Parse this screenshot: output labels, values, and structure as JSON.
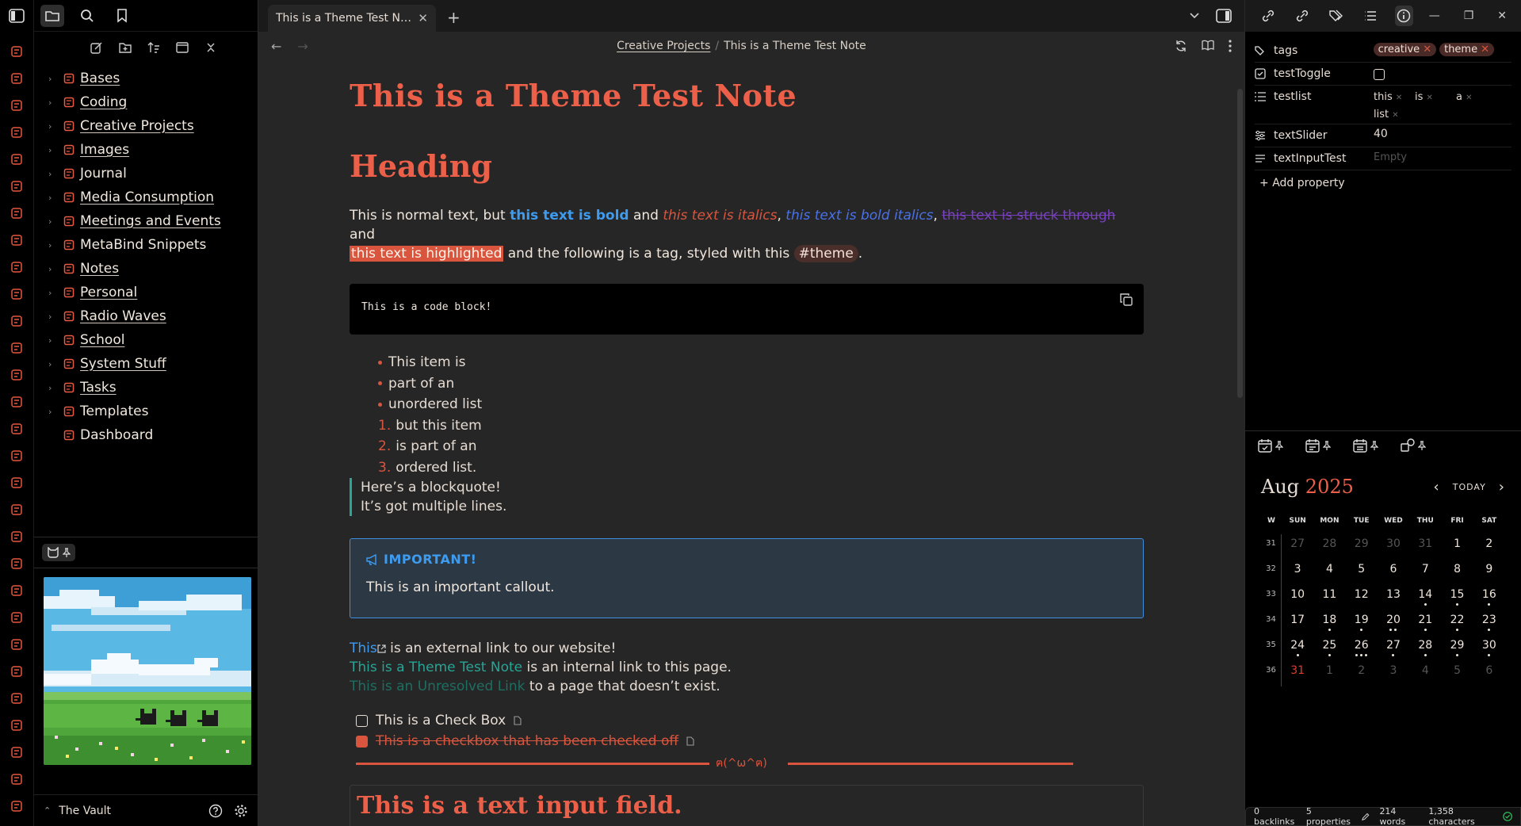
{
  "colors": {
    "accent": "#ec5f48",
    "link": "#3e9cf0",
    "internal": "#27a596"
  },
  "left_sidebar": {
    "tree": [
      {
        "label": "Bases",
        "icon": "database-icon",
        "underline": true
      },
      {
        "label": "Coding",
        "icon": "code-icon",
        "underline": true
      },
      {
        "label": "Creative Projects",
        "icon": "palette-icon",
        "underline": true
      },
      {
        "label": "Images",
        "icon": "image-icon",
        "underline": true
      },
      {
        "label": "Journal",
        "icon": "journal-icon",
        "underline": false
      },
      {
        "label": "Media Consumption",
        "icon": "tv-icon",
        "underline": true
      },
      {
        "label": "Meetings and Events",
        "icon": "monitor-icon",
        "underline": true
      },
      {
        "label": "MetaBind Snippets",
        "icon": "scissors-icon",
        "underline": false
      },
      {
        "label": "Notes",
        "icon": "note-icon",
        "underline": true
      },
      {
        "label": "Personal",
        "icon": "person-icon",
        "underline": true
      },
      {
        "label": "Radio Waves",
        "icon": "radio-icon",
        "underline": true
      },
      {
        "label": "School",
        "icon": "school-icon",
        "underline": true
      },
      {
        "label": "System Stuff",
        "icon": "gear-icon",
        "underline": true
      },
      {
        "label": "Tasks",
        "icon": "tasks-icon",
        "underline": true
      },
      {
        "label": "Templates",
        "icon": "template-icon",
        "underline": false
      },
      {
        "label": "Dashboard",
        "icon": "dashboard-icon",
        "underline": false,
        "no_chevron": true
      }
    ],
    "vault_name": "The Vault"
  },
  "tab": {
    "title": "This is a Theme Test N…"
  },
  "breadcrumb": {
    "folder": "Creative Projects",
    "sep": "/",
    "note": "This is a Theme Test Note"
  },
  "note": {
    "title": "This is a Theme Test Note",
    "heading": "Heading",
    "p1": {
      "t1": "This is normal text, but ",
      "bold": "this text is bold",
      "t2": " and ",
      "italics": "this text is italics",
      "t3": ", ",
      "bolditalics": "this text is bold italics",
      "t4": ", ",
      "strike": "this text is struck through",
      "t5": " and",
      "highlight": "this text is highlighted",
      "t6": " and the following is a tag, styled with this ",
      "tag": "#theme",
      "t7": "."
    },
    "code": "This is a code block!",
    "ul": [
      "This item is",
      "part of an",
      "unordered list"
    ],
    "ol": [
      {
        "n": "1.",
        "t": "but this item"
      },
      {
        "n": "2.",
        "t": "is part of an"
      },
      {
        "n": "3.",
        "t": "ordered list."
      }
    ],
    "blockquote": [
      "Here’s a blockquote!",
      "It’s got multiple lines."
    ],
    "callout": {
      "title": "IMPORTANT!",
      "body": "This is an important callout."
    },
    "links": {
      "ext": "This",
      "ext_rest": " is an external link to our website!",
      "int": "This is a Theme Test Note",
      "int_rest": " is an internal link to this page.",
      "unres": "This is an Unresolved Link",
      "unres_rest": " to a page that doesn’t exist."
    },
    "tasks": [
      {
        "label": "This is a Check Box",
        "checked": false
      },
      {
        "label": "This is a checkbox that has been checked off",
        "checked": true
      }
    ],
    "divider_text": "ฅ(^ω^ฅ)",
    "input_heading": "This is a text input field."
  },
  "properties": [
    {
      "key": "tags",
      "icon": "tags-icon",
      "type": "tags",
      "values": [
        "creative",
        "theme"
      ]
    },
    {
      "key": "testToggle",
      "icon": "checkbox-icon",
      "type": "checkbox",
      "checked": false
    },
    {
      "key": "testlist",
      "icon": "list-icon",
      "type": "list",
      "values": [
        "this",
        "is",
        "a",
        "list"
      ]
    },
    {
      "key": "textSlider",
      "icon": "slider-icon",
      "type": "number",
      "value": "40"
    },
    {
      "key": "textInputTest",
      "icon": "text-icon",
      "type": "text",
      "value": "",
      "placeholder": "Empty"
    }
  ],
  "add_property": "Add property",
  "calendar": {
    "month": "Aug",
    "year": "2025",
    "today_label": "TODAY",
    "headers": [
      "W",
      "SUN",
      "MON",
      "TUE",
      "WED",
      "THU",
      "FRI",
      "SAT"
    ],
    "weeks": [
      {
        "w": "31",
        "days": [
          [
            "27",
            1,
            0
          ],
          [
            "28",
            1,
            0
          ],
          [
            "29",
            1,
            0
          ],
          [
            "30",
            1,
            0
          ],
          [
            "31",
            1,
            0
          ],
          [
            "1",
            0,
            0
          ],
          [
            "2",
            0,
            0
          ]
        ]
      },
      {
        "w": "32",
        "days": [
          [
            "3",
            0,
            0
          ],
          [
            "4",
            0,
            0
          ],
          [
            "5",
            0,
            0
          ],
          [
            "6",
            0,
            0
          ],
          [
            "7",
            0,
            0
          ],
          [
            "8",
            0,
            0
          ],
          [
            "9",
            0,
            0
          ]
        ]
      },
      {
        "w": "33",
        "days": [
          [
            "10",
            0,
            0
          ],
          [
            "11",
            0,
            0
          ],
          [
            "12",
            0,
            0
          ],
          [
            "13",
            0,
            0
          ],
          [
            "14",
            0,
            1
          ],
          [
            "15",
            0,
            1
          ],
          [
            "16",
            0,
            1
          ]
        ]
      },
      {
        "w": "34",
        "days": [
          [
            "17",
            0,
            0
          ],
          [
            "18",
            0,
            1
          ],
          [
            "19",
            0,
            1
          ],
          [
            "20",
            0,
            2
          ],
          [
            "21",
            0,
            1
          ],
          [
            "22",
            0,
            1
          ],
          [
            "23",
            0,
            1
          ]
        ]
      },
      {
        "w": "35",
        "days": [
          [
            "24",
            0,
            1
          ],
          [
            "25",
            0,
            1
          ],
          [
            "26",
            0,
            3
          ],
          [
            "27",
            0,
            1
          ],
          [
            "28",
            0,
            1
          ],
          [
            "29",
            0,
            1
          ],
          [
            "30",
            0,
            1
          ]
        ]
      },
      {
        "w": "36",
        "days": [
          [
            "31",
            2,
            0
          ],
          [
            "1",
            1,
            0
          ],
          [
            "2",
            1,
            0
          ],
          [
            "3",
            1,
            0
          ],
          [
            "4",
            1,
            0
          ],
          [
            "5",
            1,
            0
          ],
          [
            "6",
            1,
            0
          ]
        ]
      }
    ]
  },
  "status": {
    "backlinks": "0 backlinks",
    "properties": "5 properties",
    "words": "214 words",
    "chars": "1,358 characters"
  }
}
